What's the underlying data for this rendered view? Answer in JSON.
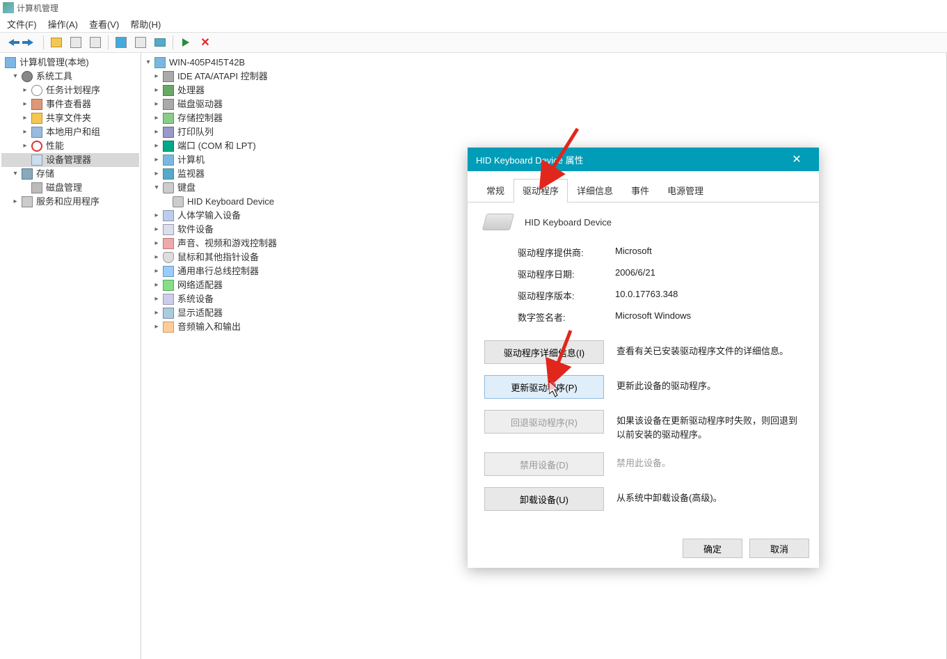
{
  "window": {
    "title": "计算机管理"
  },
  "menubar": {
    "file": "文件(F)",
    "action": "操作(A)",
    "view": "查看(V)",
    "help": "帮助(H)"
  },
  "left_tree": {
    "root": "计算机管理(本地)",
    "system_tools": "系统工具",
    "task_scheduler": "任务计划程序",
    "event_viewer": "事件查看器",
    "shared_folders": "共享文件夹",
    "local_users": "本地用户和组",
    "performance": "性能",
    "device_manager": "设备管理器",
    "storage": "存储",
    "disk_mgmt": "磁盘管理",
    "services": "服务和应用程序"
  },
  "device_tree": {
    "computer": "WIN-405P4I5T42B",
    "ide": "IDE ATA/ATAPI 控制器",
    "cpu": "处理器",
    "disk": "磁盘驱动器",
    "storage_ctrl": "存储控制器",
    "printq": "打印队列",
    "ports": "端口 (COM 和 LPT)",
    "computers": "计算机",
    "monitors": "监视器",
    "keyboards": "键盘",
    "hid_keyboard": "HID Keyboard Device",
    "hid": "人体学输入设备",
    "software_dev": "软件设备",
    "sound": "声音、视频和游戏控制器",
    "mouse": "鼠标和其他指针设备",
    "usb": "通用串行总线控制器",
    "network": "网络适配器",
    "system": "系统设备",
    "display": "显示适配器",
    "audio_io": "音频输入和输出"
  },
  "dialog": {
    "title": "HID Keyboard Device 属性",
    "tabs": {
      "general": "常规",
      "driver": "驱动程序",
      "details": "详细信息",
      "events": "事件",
      "power": "电源管理"
    },
    "device_name": "HID Keyboard Device",
    "info": {
      "provider_label": "驱动程序提供商:",
      "provider_value": "Microsoft",
      "date_label": "驱动程序日期:",
      "date_value": "2006/6/21",
      "version_label": "驱动程序版本:",
      "version_value": "10.0.17763.348",
      "signer_label": "数字签名者:",
      "signer_value": "Microsoft Windows"
    },
    "buttons": {
      "details": "驱动程序详细信息(I)",
      "details_desc": "查看有关已安装驱动程序文件的详细信息。",
      "update": "更新驱动程序(P)",
      "update_desc": "更新此设备的驱动程序。",
      "rollback": "回退驱动程序(R)",
      "rollback_desc": "如果该设备在更新驱动程序时失败，则回退到以前安装的驱动程序。",
      "disable": "禁用设备(D)",
      "disable_desc": "禁用此设备。",
      "uninstall": "卸载设备(U)",
      "uninstall_desc": "从系统中卸载设备(高级)。"
    },
    "footer": {
      "ok": "确定",
      "cancel": "取消"
    }
  }
}
